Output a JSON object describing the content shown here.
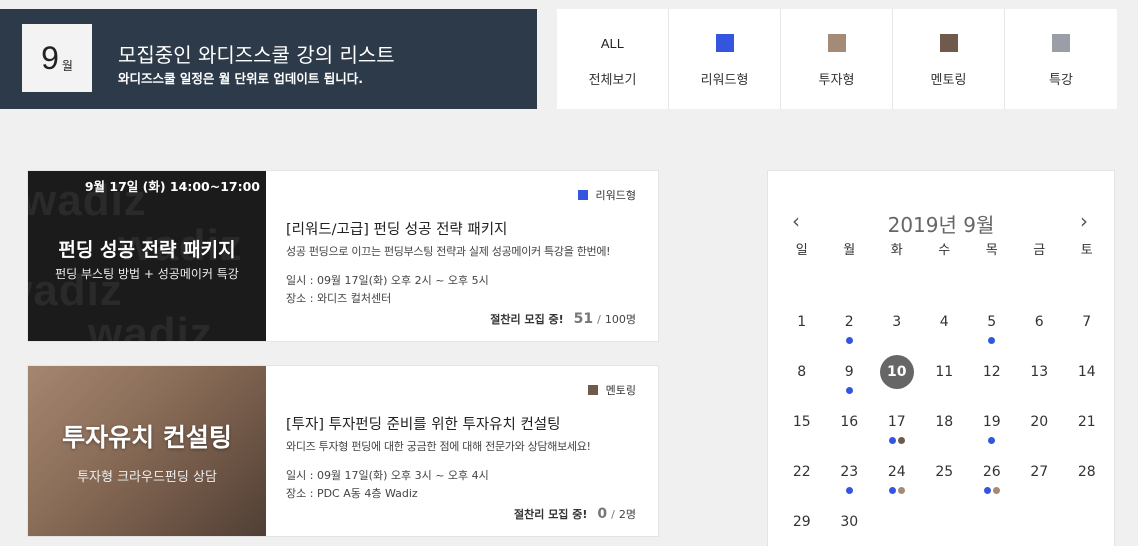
{
  "header": {
    "month_num": "9",
    "month_unit": "월",
    "title": "모집중인 와디즈스쿨 강의 리스트",
    "subtitle": "와디즈스쿨 일정은 월 단위로 업데이트 됩니다."
  },
  "filters": [
    {
      "top": "ALL",
      "label": "전체보기",
      "color": null
    },
    {
      "top": "",
      "label": "리워드형",
      "color": "#3355e0"
    },
    {
      "top": "",
      "label": "투자형",
      "color": "#a58a75"
    },
    {
      "top": "",
      "label": "멘토링",
      "color": "#6f5a4c"
    },
    {
      "top": "",
      "label": "특강",
      "color": "#9a9ea6"
    }
  ],
  "cards": [
    {
      "thumb_date": "9월 17일 (화) 14:00~17:00",
      "thumb_title": "펀딩 성공 전략 패키지",
      "thumb_sub": "펀딩 부스팅 방법 + 성공메이커 특강",
      "watermark": "wadiz",
      "tag": "리워드형",
      "tag_color": "#3355e0",
      "title": "[리워드/고급] 펀딩 성공 전략 패키지",
      "desc": "성공 펀딩으로 이끄는 펀딩부스팅 전략과 실제 성공메이커 특강을 한번에!",
      "when": "일시 : 09월 17일(화) 오후 2시 ~ 오후 5시",
      "where": "장소 : 와디즈 컬처센터",
      "status": "절찬리 모집 중!",
      "count": "51",
      "slash": "/",
      "capacity": "100명"
    },
    {
      "thumb_title": "투자유치 컨설팅",
      "thumb_sub": "투자형 크라우드펀딩 상담",
      "tag": "멘토링",
      "tag_color": "#6f5a4c",
      "title": "[투자] 투자펀딩 준비를 위한 투자유치 컨설팅",
      "desc": "와디즈 투자형 펀딩에 대한 궁금한 점에 대해 전문가와 상담해보세요!",
      "when": "일시 : 09월 17일(화) 오후 3시 ~ 오후 4시",
      "where": "장소 : PDC A동 4층 Wadiz",
      "status": "절찬리 모집 중!",
      "count": "0",
      "slash": "/",
      "capacity": "2명"
    }
  ],
  "calendar": {
    "prev": "‹",
    "next": "›",
    "title": "2019년 9월",
    "weekdays": [
      "일",
      "월",
      "화",
      "수",
      "목",
      "금",
      "토"
    ],
    "today": "10",
    "dot_colors": {
      "blue": "#3355e0",
      "brown": "#6f5a4c",
      "tan": "#a58a75"
    },
    "weeks": [
      [
        [
          "1"
        ],
        [
          "2",
          "blue"
        ],
        [
          "3"
        ],
        [
          "4"
        ],
        [
          "5",
          "blue"
        ],
        [
          "6"
        ],
        [
          "7"
        ]
      ],
      [
        [
          "8"
        ],
        [
          "9",
          "blue"
        ],
        [
          "10"
        ],
        [
          "11"
        ],
        [
          "12"
        ],
        [
          "13"
        ],
        [
          "14"
        ]
      ],
      [
        [
          "15"
        ],
        [
          "16"
        ],
        [
          "17",
          "blue",
          "brown"
        ],
        [
          "18"
        ],
        [
          "19",
          "blue"
        ],
        [
          "20"
        ],
        [
          "21"
        ]
      ],
      [
        [
          "22"
        ],
        [
          "23",
          "blue"
        ],
        [
          "24",
          "blue",
          "tan"
        ],
        [
          "25"
        ],
        [
          "26",
          "blue",
          "tan"
        ],
        [
          "27"
        ],
        [
          "28"
        ]
      ],
      [
        [
          "29"
        ],
        [
          "30"
        ]
      ]
    ]
  }
}
